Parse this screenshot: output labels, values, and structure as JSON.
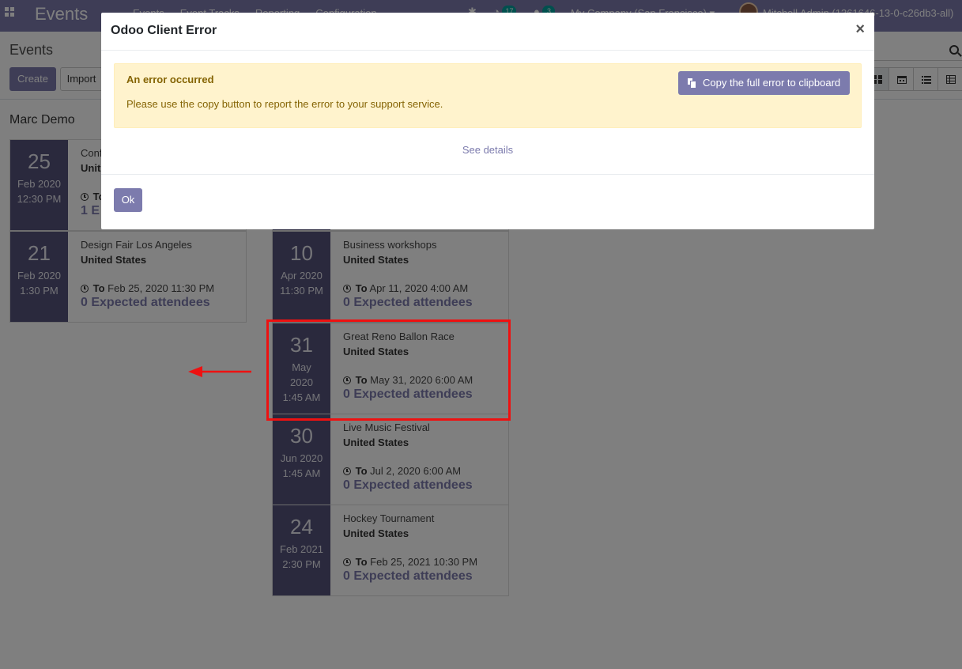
{
  "navbar": {
    "brand": "Events",
    "menu": [
      "Events",
      "Event Tracks",
      "Reporting",
      "Configuration"
    ],
    "activity_count": "17",
    "message_count": "3",
    "company": "My Company (San Francisco)",
    "user": "Mitchell Admin (1361646-13-0-c26db3-all)"
  },
  "control_panel": {
    "breadcrumb": "Events",
    "create_label": "Create",
    "import_label": "Import"
  },
  "kanban": {
    "group_title": "Marc Demo",
    "left_cards": [
      {
        "day": "25",
        "month": "Feb 2020",
        "time": "12:30 PM",
        "name": "Conf",
        "country": "Unit",
        "to_label": "To",
        "to_date": "",
        "attendees": "1 E"
      },
      {
        "day": "21",
        "month": "Feb 2020",
        "time": "1:30 PM",
        "name": "Design Fair Los Angeles",
        "country": "United States",
        "to_label": "To",
        "to_date": "Feb 25, 2020 11:30 PM",
        "attendees": "0 Expected attendees"
      }
    ],
    "right_cards": [
      {
        "day": "10",
        "month": "Apr 2020",
        "time": "11:30 PM",
        "name": "Business workshops",
        "country": "United States",
        "to_label": "To",
        "to_date": "Apr 11, 2020 4:00 AM",
        "attendees": "0 Expected attendees"
      },
      {
        "day": "31",
        "month": "May",
        "year": "2020",
        "time": "1:45 AM",
        "name": "Great Reno Ballon Race",
        "country": "United States",
        "to_label": "To",
        "to_date": "May 31, 2020 6:00 AM",
        "attendees": "0 Expected attendees"
      },
      {
        "day": "30",
        "month": "Jun 2020",
        "time": "1:45 AM",
        "name": "Live Music Festival",
        "country": "United States",
        "to_label": "To",
        "to_date": "Jul 2, 2020 6:00 AM",
        "attendees": "0 Expected attendees"
      },
      {
        "day": "24",
        "month": "Feb 2021",
        "time": "2:30 PM",
        "name": "Hockey Tournament",
        "country": "United States",
        "to_label": "To",
        "to_date": "Feb 25, 2021 10:30 PM",
        "attendees": "0 Expected attendees"
      }
    ]
  },
  "dialog": {
    "title": "Odoo Client Error",
    "close_symbol": "×",
    "alert_heading": "An error occurred",
    "alert_text": "Please use the copy button to report the error to your support service.",
    "copy_label": "Copy the full error to clipboard",
    "see_details": "See details",
    "ok_label": "Ok"
  },
  "colors": {
    "brand": "#7c7bad",
    "date_panel": "#55537a",
    "highlight": "#ee1111",
    "alert_bg": "#fff3cd"
  }
}
